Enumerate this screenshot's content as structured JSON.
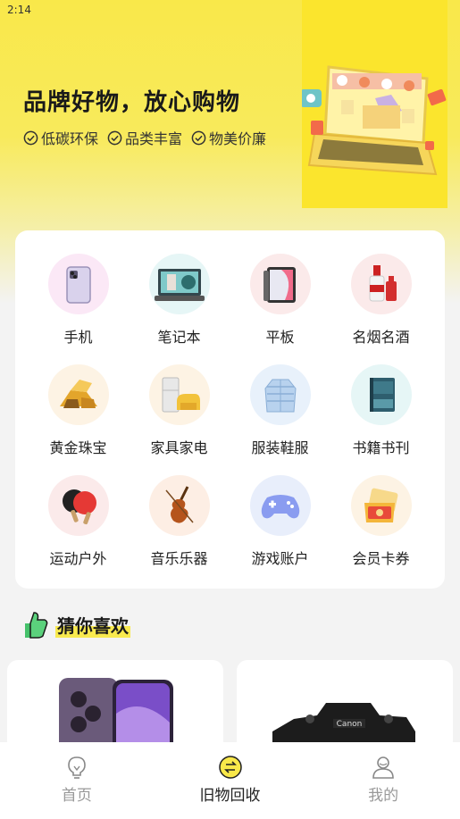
{
  "status_bar": {
    "time": "2:14"
  },
  "hero": {
    "title": "品牌好物，放心购物",
    "tags": [
      "低碳环保",
      "品类丰富",
      "物美价廉"
    ]
  },
  "categories": [
    {
      "label": "手机",
      "icon": "phone-icon"
    },
    {
      "label": "笔记本",
      "icon": "laptop-icon"
    },
    {
      "label": "平板",
      "icon": "tablet-icon"
    },
    {
      "label": "名烟名酒",
      "icon": "liquor-icon"
    },
    {
      "label": "黄金珠宝",
      "icon": "gold-icon"
    },
    {
      "label": "家具家电",
      "icon": "appliance-icon"
    },
    {
      "label": "服装鞋服",
      "icon": "jacket-icon"
    },
    {
      "label": "书籍书刊",
      "icon": "book-icon"
    },
    {
      "label": "运动户外",
      "icon": "pingpong-icon"
    },
    {
      "label": "音乐乐器",
      "icon": "violin-icon"
    },
    {
      "label": "游戏账户",
      "icon": "gamepad-icon"
    },
    {
      "label": "会员卡券",
      "icon": "coupon-icon"
    }
  ],
  "guess": {
    "title": "猜你喜欢"
  },
  "tabbar": {
    "items": [
      {
        "label": "首页",
        "icon": "lightbulb-icon",
        "active": false
      },
      {
        "label": "旧物回收",
        "icon": "recycle-icon",
        "active": true
      },
      {
        "label": "我的",
        "icon": "user-icon",
        "active": false
      }
    ]
  },
  "colors": {
    "accent": "#f9e84a",
    "text": "#222222",
    "inactive": "#999999"
  }
}
